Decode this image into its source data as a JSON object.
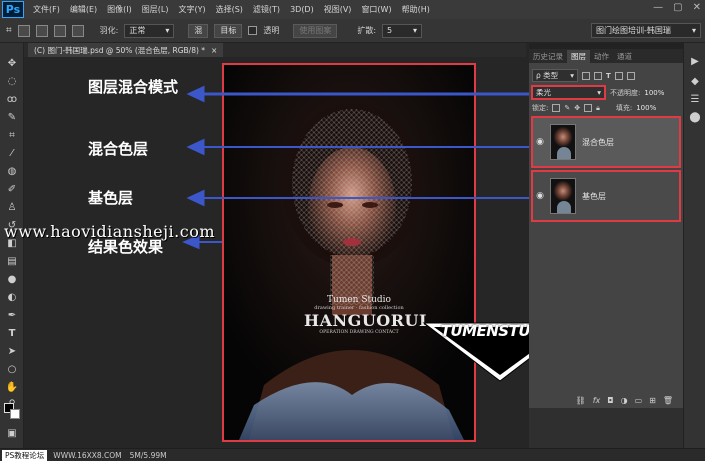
{
  "app": {
    "logo": "Ps"
  },
  "menu": [
    "文件(F)",
    "编辑(E)",
    "图像(I)",
    "图层(L)",
    "文字(Y)",
    "选择(S)",
    "滤镜(T)",
    "3D(D)",
    "视图(V)",
    "窗口(W)",
    "帮助(H)"
  ],
  "window_controls": {
    "minimize": "—",
    "maximize": "▢",
    "close": "✕"
  },
  "options_bar": {
    "feather_label": "羽化:",
    "mode_label": "正常",
    "btn_refine": "混",
    "btn_target": "目标",
    "transparent_label": "透明",
    "pattern_label": "使用图案",
    "spread_label": "扩散:",
    "spread_value": "5"
  },
  "workspace": {
    "label": "图门绘图培训-韩国瑞",
    "arrow": "▾"
  },
  "document_tab": {
    "title": "(C) 图门-韩国瑞.psd @ 50% (混合色层, RGB/8) *",
    "close": "×"
  },
  "annotations": {
    "blend_mode": "图层混合模式",
    "blend_layer": "混合色层",
    "base_layer": "基色层",
    "result": "结果色效果"
  },
  "watermark": "www.haovidiansheji.com",
  "artwork": {
    "studio_small": "Tumen Studio",
    "studio_tagline": "drawing trainer · fashion collection",
    "name": "HANGUORUI",
    "credit": "OPERATION DRAWING CONTACT",
    "logo_text": "TUMENSTUDIO"
  },
  "panel_tabs": [
    "历史记录",
    "图层",
    "动作",
    "通道"
  ],
  "layers_panel": {
    "filter_kind": "ρ 类型",
    "blend_mode": "柔光",
    "opacity_label": "不透明度:",
    "opacity_value": "100%",
    "lock_label": "锁定:",
    "fill_label": "填充:",
    "fill_value": "100%",
    "layers": [
      {
        "name": "混合色层",
        "visible": true
      },
      {
        "name": "基色层",
        "visible": true
      }
    ],
    "footer_icons": [
      "link-icon",
      "fx-icon",
      "mask-icon",
      "adjustment-icon",
      "folder-icon",
      "new-layer-icon",
      "trash-icon"
    ]
  },
  "status_bar": {
    "site": "PS教程论坛",
    "url": "WWW.16XX8.COM",
    "doc_size": "5M/5.99M"
  },
  "colors": {
    "accent_red": "#e03a45",
    "arrow_blue": "#3b57c9",
    "panel_bg": "#444444",
    "app_bg": "#262626"
  }
}
